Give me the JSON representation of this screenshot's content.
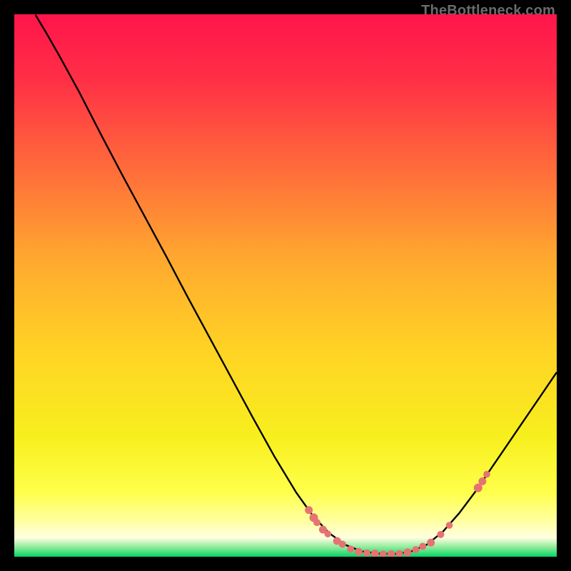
{
  "watermark": "TheBottleneck.com",
  "chart_data": {
    "type": "line",
    "title": "",
    "xlabel": "",
    "ylabel": "",
    "xlim": [
      0,
      100
    ],
    "ylim": [
      0,
      100
    ],
    "gradient_stops": [
      {
        "pos": 0.0,
        "color": "#ff154b"
      },
      {
        "pos": 0.12,
        "color": "#ff2f46"
      },
      {
        "pos": 0.28,
        "color": "#ff6a3b"
      },
      {
        "pos": 0.45,
        "color": "#ffa82f"
      },
      {
        "pos": 0.62,
        "color": "#ffd324"
      },
      {
        "pos": 0.78,
        "color": "#f7ef1e"
      },
      {
        "pos": 0.88,
        "color": "#ffff4a"
      },
      {
        "pos": 0.93,
        "color": "#ffff99"
      },
      {
        "pos": 0.965,
        "color": "#ffffe2"
      },
      {
        "pos": 0.985,
        "color": "#7de88f"
      },
      {
        "pos": 1.0,
        "color": "#00d66a"
      }
    ],
    "curve": [
      {
        "x": 3.9,
        "y": 99.9
      },
      {
        "x": 6.0,
        "y": 96.4
      },
      {
        "x": 8.5,
        "y": 92.0
      },
      {
        "x": 12.0,
        "y": 85.6
      },
      {
        "x": 16.0,
        "y": 77.8
      },
      {
        "x": 20.0,
        "y": 70.2
      },
      {
        "x": 24.0,
        "y": 62.8
      },
      {
        "x": 28.0,
        "y": 55.4
      },
      {
        "x": 32.0,
        "y": 47.8
      },
      {
        "x": 36.0,
        "y": 40.4
      },
      {
        "x": 40.0,
        "y": 33.0
      },
      {
        "x": 44.0,
        "y": 25.6
      },
      {
        "x": 48.0,
        "y": 18.4
      },
      {
        "x": 52.0,
        "y": 11.8
      },
      {
        "x": 55.0,
        "y": 7.6
      },
      {
        "x": 58.0,
        "y": 4.4
      },
      {
        "x": 61.0,
        "y": 2.2
      },
      {
        "x": 64.0,
        "y": 1.0
      },
      {
        "x": 67.0,
        "y": 0.6
      },
      {
        "x": 70.0,
        "y": 0.5
      },
      {
        "x": 73.0,
        "y": 0.9
      },
      {
        "x": 76.0,
        "y": 2.2
      },
      {
        "x": 79.0,
        "y": 4.6
      },
      {
        "x": 82.0,
        "y": 8.0
      },
      {
        "x": 85.0,
        "y": 12.0
      },
      {
        "x": 88.0,
        "y": 16.4
      },
      {
        "x": 91.0,
        "y": 20.8
      },
      {
        "x": 94.0,
        "y": 25.2
      },
      {
        "x": 97.0,
        "y": 29.6
      },
      {
        "x": 100.0,
        "y": 34.0
      }
    ],
    "markers": [
      {
        "x": 54.3,
        "y": 8.6,
        "r": 5.5
      },
      {
        "x": 55.2,
        "y": 7.2,
        "r": 6.0
      },
      {
        "x": 55.8,
        "y": 6.3,
        "r": 5.0
      },
      {
        "x": 56.9,
        "y": 5.0,
        "r": 5.5
      },
      {
        "x": 57.8,
        "y": 4.2,
        "r": 4.8
      },
      {
        "x": 59.5,
        "y": 2.9,
        "r": 5.5
      },
      {
        "x": 60.5,
        "y": 2.3,
        "r": 5.0
      },
      {
        "x": 62.0,
        "y": 1.4,
        "r": 5.0
      },
      {
        "x": 63.5,
        "y": 0.9,
        "r": 5.5
      },
      {
        "x": 65.0,
        "y": 0.7,
        "r": 5.0
      },
      {
        "x": 66.5,
        "y": 0.6,
        "r": 5.5
      },
      {
        "x": 68.0,
        "y": 0.5,
        "r": 5.0
      },
      {
        "x": 69.5,
        "y": 0.5,
        "r": 5.5
      },
      {
        "x": 71.0,
        "y": 0.6,
        "r": 5.0
      },
      {
        "x": 72.5,
        "y": 0.8,
        "r": 5.5
      },
      {
        "x": 74.0,
        "y": 1.3,
        "r": 5.0
      },
      {
        "x": 75.3,
        "y": 1.9,
        "r": 5.0
      },
      {
        "x": 76.8,
        "y": 2.6,
        "r": 5.5
      },
      {
        "x": 78.6,
        "y": 4.1,
        "r": 5.0
      },
      {
        "x": 80.2,
        "y": 5.8,
        "r": 4.8
      },
      {
        "x": 85.5,
        "y": 12.7,
        "r": 6.0
      },
      {
        "x": 86.3,
        "y": 13.9,
        "r": 5.5
      },
      {
        "x": 87.1,
        "y": 15.2,
        "r": 4.8
      }
    ]
  }
}
